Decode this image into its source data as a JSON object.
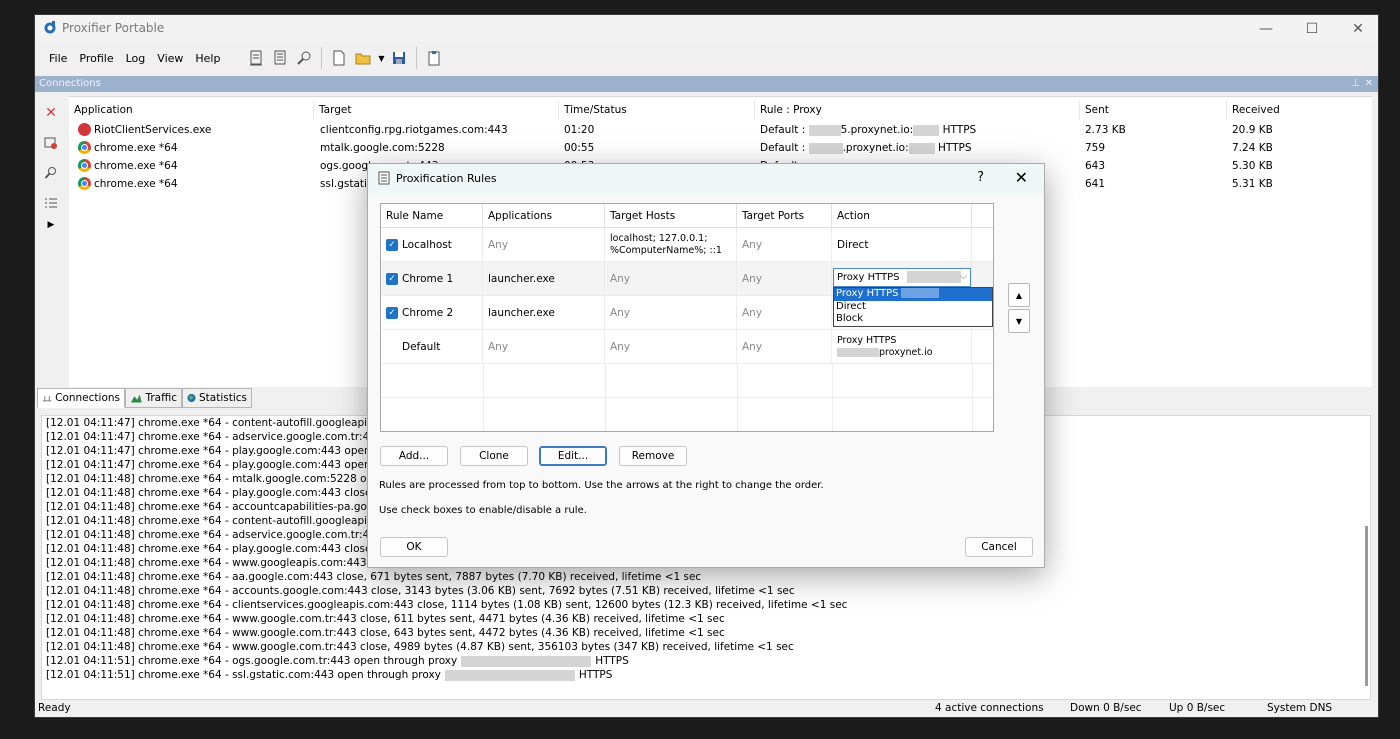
{
  "app": {
    "title": "Proxifier Portable",
    "controls": {
      "minimize": "—",
      "maximize": "☐",
      "close": "✕"
    }
  },
  "menu": [
    "File",
    "Profile",
    "Log",
    "View",
    "Help"
  ],
  "connections_panel": {
    "title": "Connections",
    "pin": "⊥",
    "close": "✕",
    "columns": [
      "Application",
      "Target",
      "Time/Status",
      "Rule : Proxy",
      "Sent",
      "Received"
    ],
    "rows": [
      {
        "icon": "riot-icon",
        "app": "RiotClientServices.exe",
        "target": "clientconfig.rpg.riotgames.com:443",
        "time": "01:20",
        "rule_prefix": "Default : ",
        "rule_mid": "5.proxynet.io:",
        "rule_suffix": " HTTPS",
        "sent": "2.73 KB",
        "received": "20.9 KB"
      },
      {
        "icon": "chrome-icon",
        "app": "chrome.exe *64",
        "target": "mtalk.google.com:5228",
        "time": "00:55",
        "rule_prefix": "Default : ",
        "rule_mid": ".proxynet.io:",
        "rule_suffix": " HTTPS",
        "sent": "759",
        "received": "7.24 KB"
      },
      {
        "icon": "chrome-icon",
        "app": "chrome.exe *64",
        "target": "ogs.google.com.tr:443",
        "time": "00:53",
        "rule_prefix": "Default : ",
        "rule_mid": "",
        "rule_suffix": "",
        "sent": "643",
        "received": "5.30 KB"
      },
      {
        "icon": "chrome-icon",
        "app": "chrome.exe *64",
        "target": "ssl.gstatic.com:443",
        "time": "",
        "rule_prefix": "",
        "rule_mid": "",
        "rule_suffix": "",
        "sent": "641",
        "received": "5.31 KB"
      }
    ]
  },
  "tabs": [
    "Connections",
    "Traffic",
    "Statistics"
  ],
  "log": [
    "[12.01 04:11:47] chrome.exe *64 - content-autofill.googleapis.com",
    "[12.01 04:11:47] chrome.exe *64 - adservice.google.com.tr:443 open through",
    "[12.01 04:11:47] chrome.exe *64 - play.google.com:443 open through",
    "[12.01 04:11:47] chrome.exe *64 - play.google.com:443 open through",
    "[12.01 04:11:48] chrome.exe *64 - mtalk.google.com:5228 open through",
    "[12.01 04:11:48] chrome.exe *64 - play.google.com:443 close, 663",
    "[12.01 04:11:48] chrome.exe *64 - accountcapabilities-pa.googleapis",
    "[12.01 04:11:48] chrome.exe *64 - content-autofill.googleapis.com",
    "[12.01 04:11:48] chrome.exe *64 - adservice.google.com.tr:443 close",
    "[12.01 04:11:48] chrome.exe *64 - play.google.com:443 close, 599",
    "[12.01 04:11:48] chrome.exe *64 - www.googleapis.com:443 close",
    "[12.01 04:11:48] chrome.exe *64 - aa.google.com:443 close, 671 bytes sent, 7887 bytes (7.70 KB) received, lifetime <1 sec",
    "[12.01 04:11:48] chrome.exe *64 - accounts.google.com:443 close, 3143 bytes (3.06 KB) sent, 7692 bytes (7.51 KB) received, lifetime <1 sec",
    "[12.01 04:11:48] chrome.exe *64 - clientservices.googleapis.com:443 close, 1114 bytes (1.08 KB) sent, 12600 bytes (12.3 KB) received, lifetime <1 sec",
    "[12.01 04:11:48] chrome.exe *64 - www.google.com.tr:443 close, 611 bytes sent, 4471 bytes (4.36 KB) received, lifetime <1 sec",
    "[12.01 04:11:48] chrome.exe *64 - www.google.com.tr:443 close, 643 bytes sent, 4472 bytes (4.36 KB) received, lifetime <1 sec",
    "[12.01 04:11:48] chrome.exe *64 - www.google.com.tr:443 close, 4989 bytes (4.87 KB) sent, 356103 bytes (347 KB) received, lifetime <1 sec",
    "[12.01 04:11:51] chrome.exe *64 - ogs.google.com.tr:443 open through proxy",
    "[12.01 04:11:51] chrome.exe *64 - ssl.gstatic.com:443 open through proxy"
  ],
  "log_suffix": "HTTPS",
  "status": {
    "ready": "Ready",
    "connections": "4 active connections",
    "down": "Down 0 B/sec",
    "up": "Up 0 B/sec",
    "dns": "System DNS"
  },
  "dialog": {
    "title": "Proxification Rules",
    "help": "?",
    "close": "✕",
    "columns": [
      "Rule Name",
      "Applications",
      "Target Hosts",
      "Target Ports",
      "Action"
    ],
    "rules": [
      {
        "name": "Localhost",
        "checked": true,
        "apps": "Any",
        "hosts_line1": "localhost; 127.0.0.1;",
        "hosts_line2": "%ComputerName%; ::1",
        "ports": "Any",
        "action": "Direct"
      },
      {
        "name": "Chrome 1",
        "checked": true,
        "apps": "launcher.exe",
        "hosts": "Any",
        "ports": "Any",
        "action": "Proxy HTTPS"
      },
      {
        "name": "Chrome 2",
        "checked": true,
        "apps": "launcher.exe",
        "hosts": "Any",
        "ports": "Any",
        "action": ""
      },
      {
        "name": "Default",
        "checked": false,
        "apps": "Any",
        "hosts": "Any",
        "ports": "Any",
        "action_line1": "Proxy HTTPS",
        "action_line2": "proxynet.io"
      }
    ],
    "dropdown_options": [
      {
        "label": "Proxy HTTPS",
        "suffix": "proxynet.io",
        "selected": true
      },
      {
        "label": "Direct",
        "selected": false
      },
      {
        "label": "Block",
        "selected": false
      }
    ],
    "buttons": {
      "add": "Add...",
      "clone": "Clone",
      "edit": "Edit...",
      "remove": "Remove",
      "ok": "OK",
      "cancel": "Cancel",
      "up": "▲",
      "down": "▼"
    },
    "hint1": "Rules are processed from top to bottom. Use the arrows at the right to change the order.",
    "hint2": "Use check boxes to enable/disable a rule."
  }
}
